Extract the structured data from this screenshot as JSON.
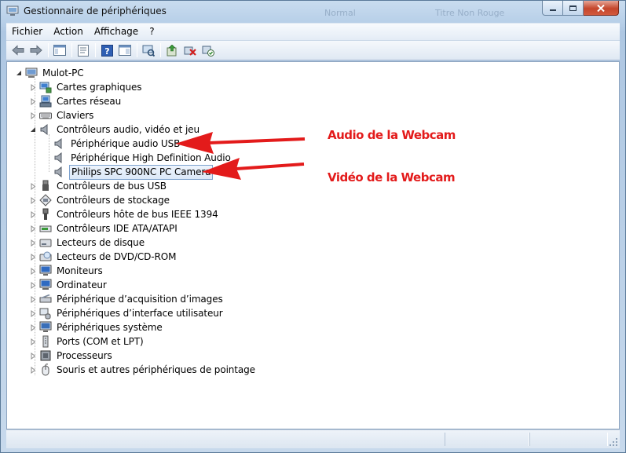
{
  "window": {
    "title": "Gestionnaire de périphériques",
    "ghost_left": "Normal",
    "ghost_right": "Titre Non Rouge"
  },
  "menu": [
    {
      "label": "Fichier"
    },
    {
      "label": "Action"
    },
    {
      "label": "Affichage"
    },
    {
      "label": "?"
    }
  ],
  "tree": {
    "root": "Mulot-PC",
    "categories": [
      {
        "label": "Cartes graphiques",
        "icon": "display-adapter-icon",
        "expanded": false
      },
      {
        "label": "Cartes réseau",
        "icon": "network-adapter-icon",
        "expanded": false
      },
      {
        "label": "Claviers",
        "icon": "keyboard-icon",
        "expanded": false
      },
      {
        "label": "Contrôleurs audio, vidéo et jeu",
        "icon": "speaker-icon",
        "expanded": true,
        "children": [
          {
            "label": "Périphérique audio USB",
            "icon": "speaker-icon",
            "selected": false
          },
          {
            "label": "Périphérique High Definition Audio",
            "icon": "speaker-icon",
            "selected": false
          },
          {
            "label": "Philips SPC 900NC PC Camera",
            "icon": "speaker-icon",
            "selected": true
          }
        ]
      },
      {
        "label": "Contrôleurs de bus USB",
        "icon": "usb-icon",
        "expanded": false
      },
      {
        "label": "Contrôleurs de stockage",
        "icon": "storage-controller-icon",
        "expanded": false
      },
      {
        "label": "Contrôleurs hôte de bus IEEE 1394",
        "icon": "firewire-icon",
        "expanded": false
      },
      {
        "label": "Contrôleurs IDE ATA/ATAPI",
        "icon": "ide-controller-icon",
        "expanded": false
      },
      {
        "label": "Lecteurs de disque",
        "icon": "disk-drive-icon",
        "expanded": false
      },
      {
        "label": "Lecteurs de DVD/CD-ROM",
        "icon": "dvd-drive-icon",
        "expanded": false
      },
      {
        "label": "Moniteurs",
        "icon": "monitor-icon",
        "expanded": false
      },
      {
        "label": "Ordinateur",
        "icon": "computer-icon",
        "expanded": false
      },
      {
        "label": "Périphérique d’acquisition d’images",
        "icon": "scanner-icon",
        "expanded": false
      },
      {
        "label": "Périphériques d’interface utilisateur",
        "icon": "hid-icon",
        "expanded": false
      },
      {
        "label": "Périphériques système",
        "icon": "system-devices-icon",
        "expanded": false
      },
      {
        "label": "Ports (COM et LPT)",
        "icon": "port-icon",
        "expanded": false
      },
      {
        "label": "Processeurs",
        "icon": "processor-icon",
        "expanded": false
      },
      {
        "label": "Souris et autres périphériques de pointage",
        "icon": "mouse-icon",
        "expanded": false
      }
    ]
  },
  "annotations": {
    "audio": "Audio de la Webcam",
    "video": "Vidéo de la Webcam",
    "color": "#e31b1b"
  },
  "colors": {
    "selection_border": "#7da2ce",
    "window_frame": "#b7cfe8",
    "close_button": "#c4462c"
  }
}
